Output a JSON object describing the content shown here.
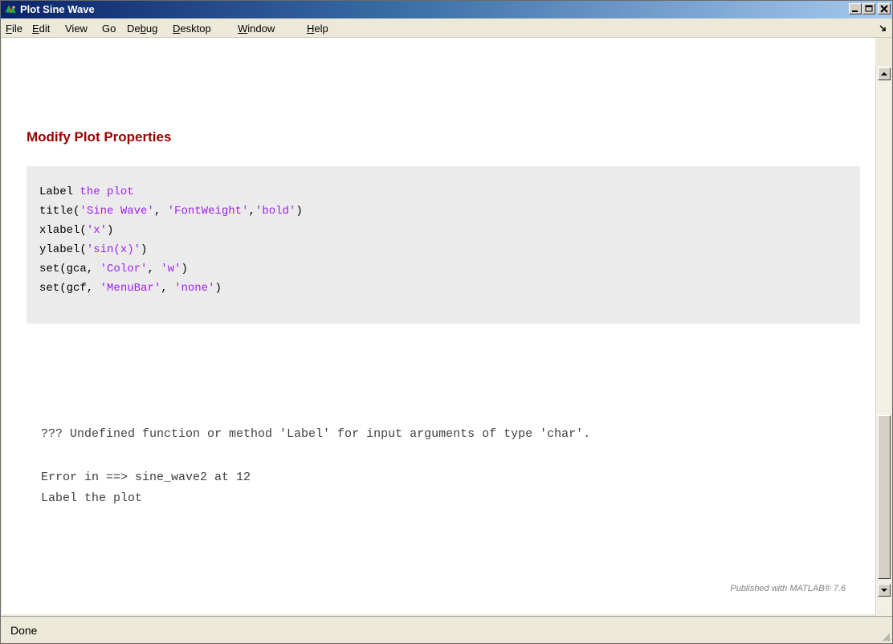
{
  "window": {
    "title": "Plot Sine Wave",
    "icon": "matlab-icon"
  },
  "menu": {
    "file": {
      "label_pre": "",
      "label_ul": "F",
      "label_post": "ile"
    },
    "edit": {
      "label_pre": "",
      "label_ul": "E",
      "label_post": "dit"
    },
    "view": {
      "label": "View"
    },
    "go": {
      "label": "Go"
    },
    "debug": {
      "label_pre": "De",
      "label_ul": "b",
      "label_post": "ug"
    },
    "desktop": {
      "label_pre": "",
      "label_ul": "D",
      "label_post": "esktop"
    },
    "window": {
      "label_pre": "",
      "label_ul": "W",
      "label_post": "indow"
    },
    "help": {
      "label_pre": "",
      "label_ul": "H",
      "label_post": "elp"
    }
  },
  "document": {
    "heading": "Modify Plot Properties",
    "code": [
      {
        "plain": "Label ",
        "str": "the plot",
        "rest": ""
      },
      {
        "plain": "title(",
        "str": "'Sine Wave'",
        "rest": ", "
      },
      {
        "plain": "xlabel(",
        "str": "'x'",
        "rest": ")"
      },
      {
        "plain": "ylabel(",
        "str": "'sin(x)'",
        "rest": ")"
      },
      {
        "plain": "set(gca, ",
        "str": "'Color'",
        "rest": ", "
      },
      {
        "plain": "set(gcf, ",
        "str": "'MenuBar'",
        "rest": ", "
      }
    ],
    "code_extra": {
      "line2_str2": "'FontWeight'",
      "line2_sep": ",",
      "line2_str3": "'bold'",
      "line2_end": ")",
      "line5_str2": "'w'",
      "line5_end": ")",
      "line6_str2": "'none'",
      "line6_end": ")"
    },
    "output": [
      "??? Undefined function or method 'Label' for input arguments of type 'char'.",
      "Error in ==> sine_wave2 at 12",
      "Label the plot"
    ],
    "footer": "Published with MATLAB® 7.6"
  },
  "status": {
    "text": "Done"
  }
}
